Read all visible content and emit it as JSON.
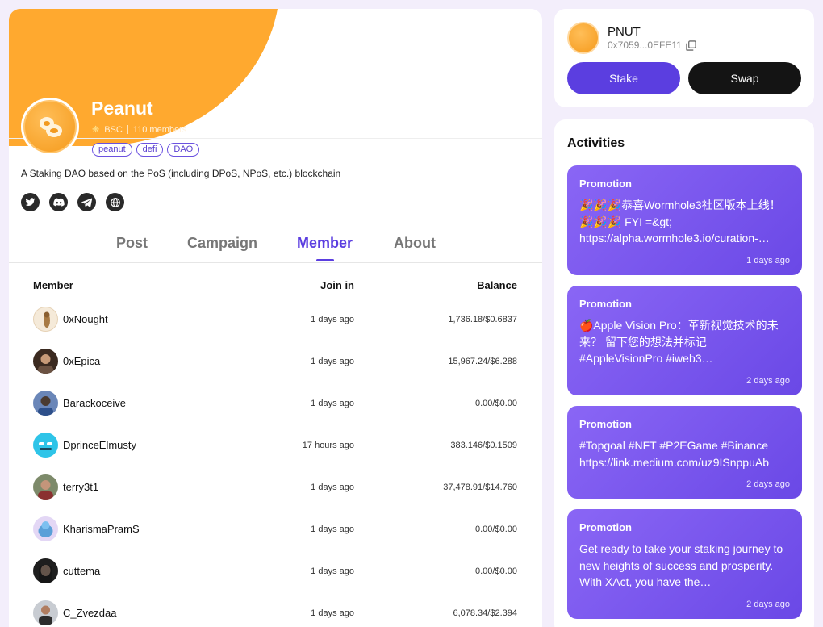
{
  "community": {
    "name": "Peanut",
    "chain": "BSC",
    "members_count": "110 members",
    "tags": [
      "peanut",
      "defi",
      "DAO"
    ],
    "description": "A Staking DAO based on the PoS (including DPoS, NPoS, etc.) blockchain",
    "socials": [
      "twitter-icon",
      "discord-icon",
      "telegram-icon",
      "globe-icon"
    ],
    "banner_color": "#ffa92f"
  },
  "tabs": [
    {
      "label": "Post",
      "active": false
    },
    {
      "label": "Campaign",
      "active": false
    },
    {
      "label": "Member",
      "active": true
    },
    {
      "label": "About",
      "active": false
    }
  ],
  "table": {
    "headers": {
      "member": "Member",
      "join": "Join in",
      "balance": "Balance"
    },
    "rows": [
      {
        "name": "0xNought",
        "join": "1 days ago",
        "balance": "1,736.18/$0.6837"
      },
      {
        "name": "0xEpica",
        "join": "1 days ago",
        "balance": "15,967.24/$6.288"
      },
      {
        "name": "Barackoceive",
        "join": "1 days ago",
        "balance": "0.00/$0.00"
      },
      {
        "name": "DprinceElmusty",
        "join": "17 hours ago",
        "balance": "383.146/$0.1509"
      },
      {
        "name": "terry3t1",
        "join": "1 days ago",
        "balance": "37,478.91/$14.760"
      },
      {
        "name": "KharismaPramS",
        "join": "1 days ago",
        "balance": "0.00/$0.00"
      },
      {
        "name": "cuttema",
        "join": "1 days ago",
        "balance": "0.00/$0.00"
      },
      {
        "name": "C_Zvezdaa",
        "join": "1 days ago",
        "balance": "6,078.34/$2.394"
      }
    ]
  },
  "token": {
    "symbol": "PNUT",
    "address": "0x7059...0EFE11",
    "stake_label": "Stake",
    "swap_label": "Swap"
  },
  "activities": {
    "title": "Activities",
    "items": [
      {
        "title": "Promotion",
        "text": "🎉🎉🎉恭喜Wormhole3社区版本上线！🎉🎉🎉 FYI =&gt; https://alpha.wormhole3.io/curation-…",
        "time": "1 days ago"
      },
      {
        "title": "Promotion",
        "text": "🍎Apple Vision Pro：革新视觉技术的未来？ 留下您的想法并标记 #AppleVisionPro #iweb3…",
        "time": "2 days ago"
      },
      {
        "title": "Promotion",
        "text": "#Topgoal #NFT #P2EGame #Binance https://link.medium.com/uz9ISnppuAb",
        "time": "2 days ago"
      },
      {
        "title": "Promotion",
        "text": "Get ready to take your staking journey to new heights of success and prosperity. With XAct, you have the…",
        "time": "2 days ago"
      }
    ]
  },
  "colors": {
    "accent": "#5b3ee0",
    "promo": "#7b58ef"
  }
}
